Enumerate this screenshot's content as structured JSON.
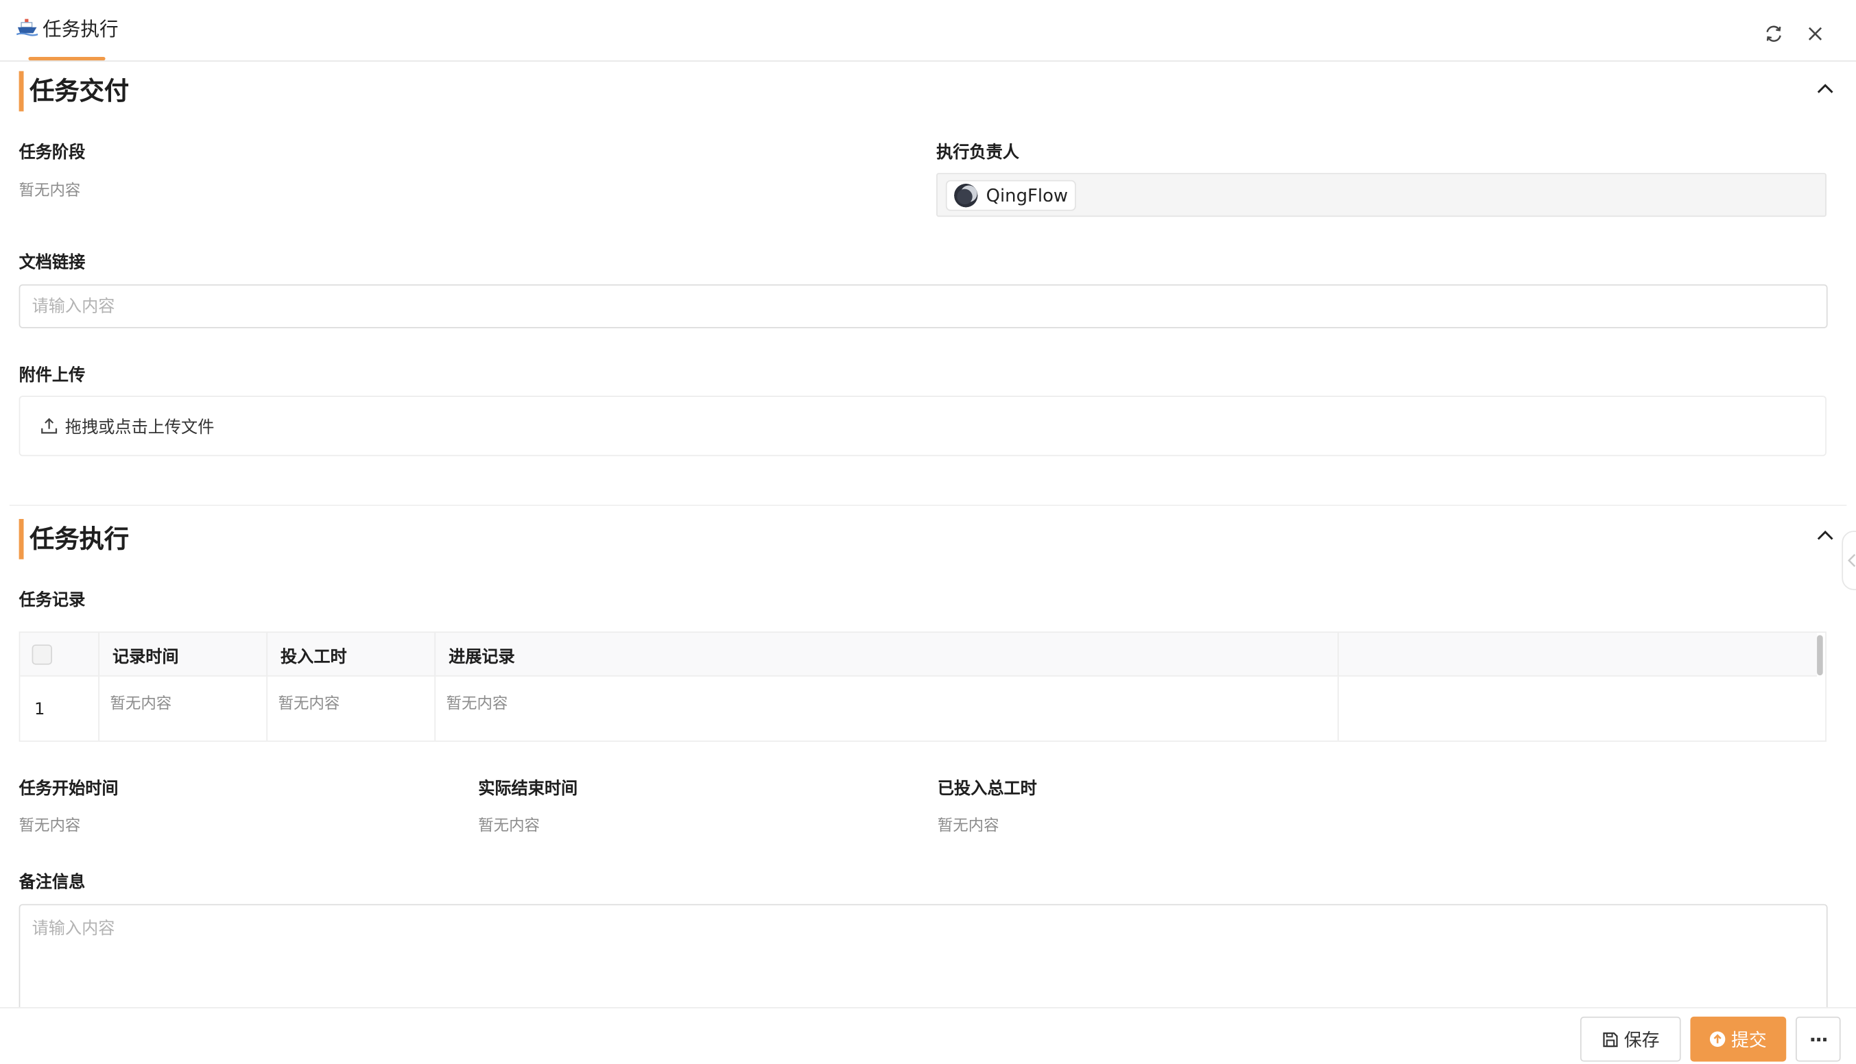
{
  "tab": {
    "title": "任务执行",
    "icon": "ship-icon"
  },
  "header_actions": {
    "refresh_icon": "refresh-icon",
    "close_icon": "close-icon"
  },
  "delivery": {
    "title": "任务交付",
    "stage_label": "任务阶段",
    "stage_value": "暂无内容",
    "owner_label": "执行负责人",
    "owner_name": "QingFlow",
    "doc_label": "文档链接",
    "doc_placeholder": "请输入内容",
    "attachment_label": "附件上传",
    "upload_text": "拖拽或点击上传文件"
  },
  "execution": {
    "title": "任务执行",
    "records_label": "任务记录",
    "table": {
      "columns": [
        "记录时间",
        "投入工时",
        "进展记录"
      ],
      "rows": [
        {
          "index": "1",
          "cells": [
            "暂无内容",
            "暂无内容",
            "暂无内容"
          ]
        }
      ]
    },
    "start_label": "任务开始时间",
    "start_value": "暂无内容",
    "end_label": "实际结束时间",
    "end_value": "暂无内容",
    "hours_label": "已投入总工时",
    "hours_value": "暂无内容",
    "remark_label": "备注信息",
    "remark_placeholder": "请输入内容"
  },
  "footer": {
    "save_label": "保存",
    "submit_label": "提交",
    "more_label": "···"
  },
  "colors": {
    "accent": "#f19a49",
    "muted_text": "#8c8c8c",
    "border": "#dcdcdc"
  }
}
